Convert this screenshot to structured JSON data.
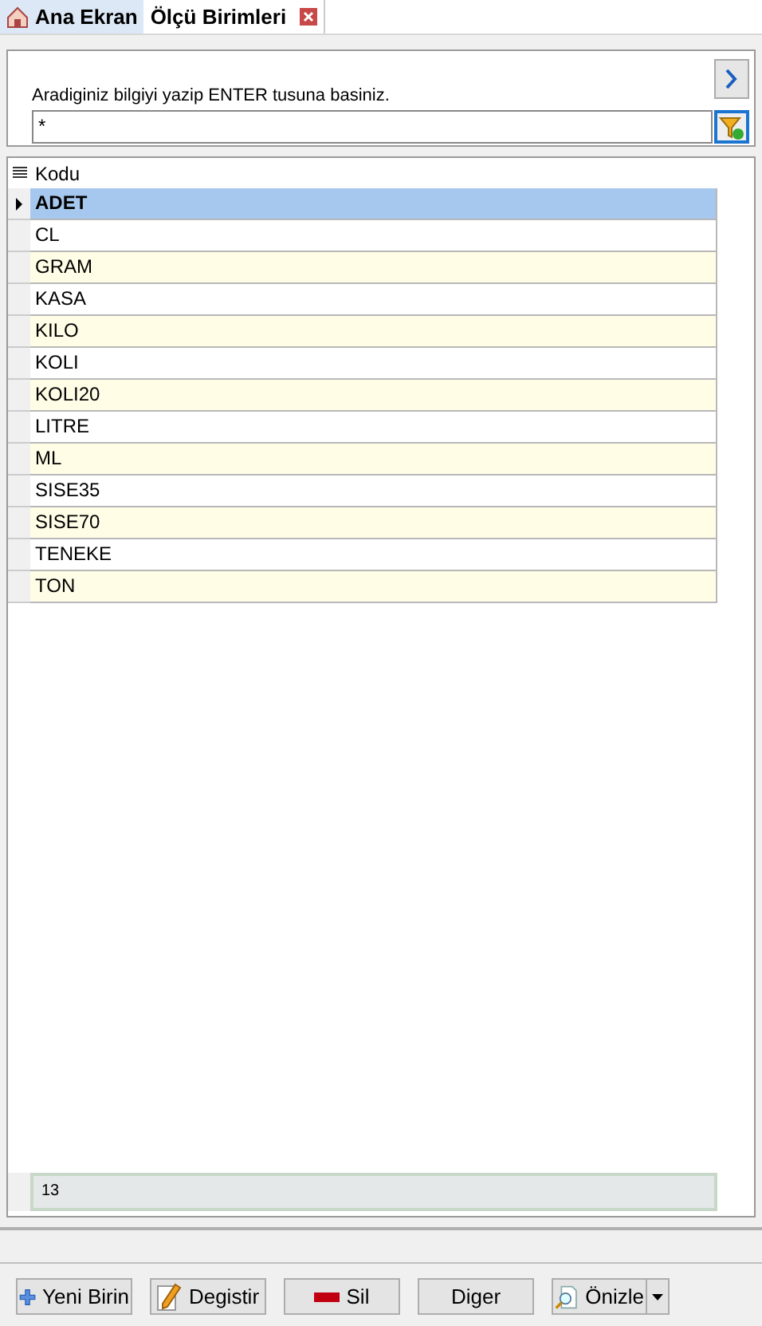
{
  "tabs": [
    {
      "label": "Ana Ekran",
      "selected": false,
      "closable": false
    },
    {
      "label": "Ölçü Birimleri",
      "selected": true,
      "closable": true
    }
  ],
  "search": {
    "label": "Aradiginiz bilgiyi yazip ENTER tusuna basiniz.",
    "value": "*"
  },
  "table": {
    "columns": [
      "Kodu"
    ],
    "rows": [
      {
        "kodu": "ADET",
        "selected": true
      },
      {
        "kodu": "CL",
        "selected": false
      },
      {
        "kodu": "GRAM",
        "selected": false
      },
      {
        "kodu": "KASA",
        "selected": false
      },
      {
        "kodu": "KILO",
        "selected": false
      },
      {
        "kodu": "KOLI",
        "selected": false
      },
      {
        "kodu": "KOLI20",
        "selected": false
      },
      {
        "kodu": "LITRE",
        "selected": false
      },
      {
        "kodu": "ML",
        "selected": false
      },
      {
        "kodu": "SISE35",
        "selected": false
      },
      {
        "kodu": "SISE70",
        "selected": false
      },
      {
        "kodu": "TENEKE",
        "selected": false
      },
      {
        "kodu": "TON",
        "selected": false
      }
    ],
    "footer_count": "13"
  },
  "buttons": [
    {
      "label": "Yeni Birin",
      "kind": "add"
    },
    {
      "label": "Degistir",
      "kind": "edit"
    },
    {
      "label": "Sil",
      "kind": "delete"
    },
    {
      "label": "Diger",
      "kind": "plain"
    },
    {
      "label": "Önizle",
      "kind": "preview"
    }
  ]
}
